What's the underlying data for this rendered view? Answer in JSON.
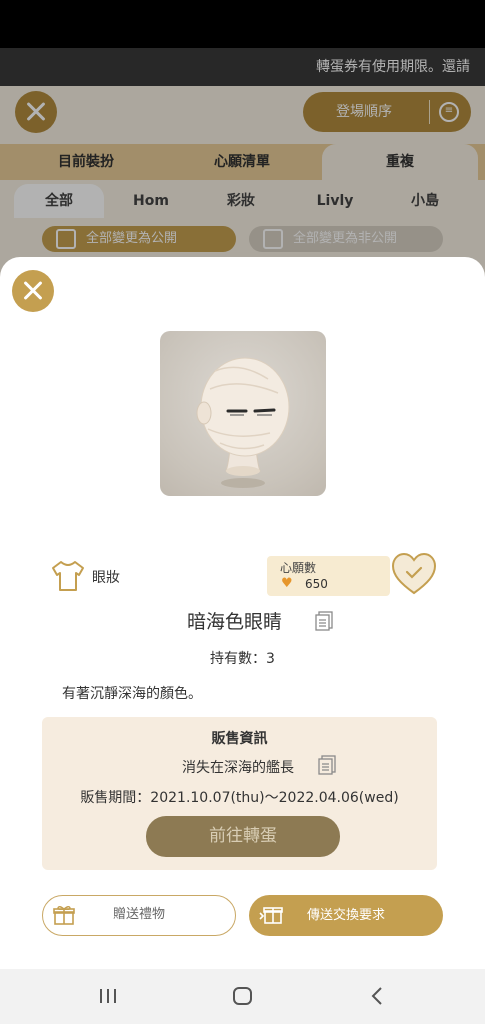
{
  "ticker": {
    "text": "轉蛋券有使用期限。還請"
  },
  "header": {
    "sort_label": "登場順序"
  },
  "main_tabs": [
    {
      "label": "目前裝扮"
    },
    {
      "label": "心願清單"
    },
    {
      "label": "重複"
    }
  ],
  "category_tabs": [
    {
      "label": "全部"
    },
    {
      "label": "Hom"
    },
    {
      "label": "彩妝"
    },
    {
      "label": "Livly"
    },
    {
      "label": "小島"
    }
  ],
  "visibility": {
    "make_public": "全部變更為公開",
    "make_private": "全部變更為非公開"
  },
  "item": {
    "category": "眼妝",
    "wish_title": "心願數",
    "wish_count": "650",
    "name": "暗海色眼睛",
    "owned": "持有數：3",
    "description": "有著沉靜深海的顏色。"
  },
  "sales": {
    "title": "販售資訊",
    "source": "消失在深海的艦長",
    "period": "販售期間：2021.10.07(thu)〜2022.04.06(wed)",
    "goto_label": "前往轉蛋"
  },
  "actions": {
    "gift_label": "贈送禮物",
    "trade_label": "傳送交換要求"
  },
  "colors": {
    "gold": "#c49f50",
    "gold_dark": "#8d7a53",
    "cream": "#f6ecdf",
    "wish_orange": "#e6962c"
  }
}
